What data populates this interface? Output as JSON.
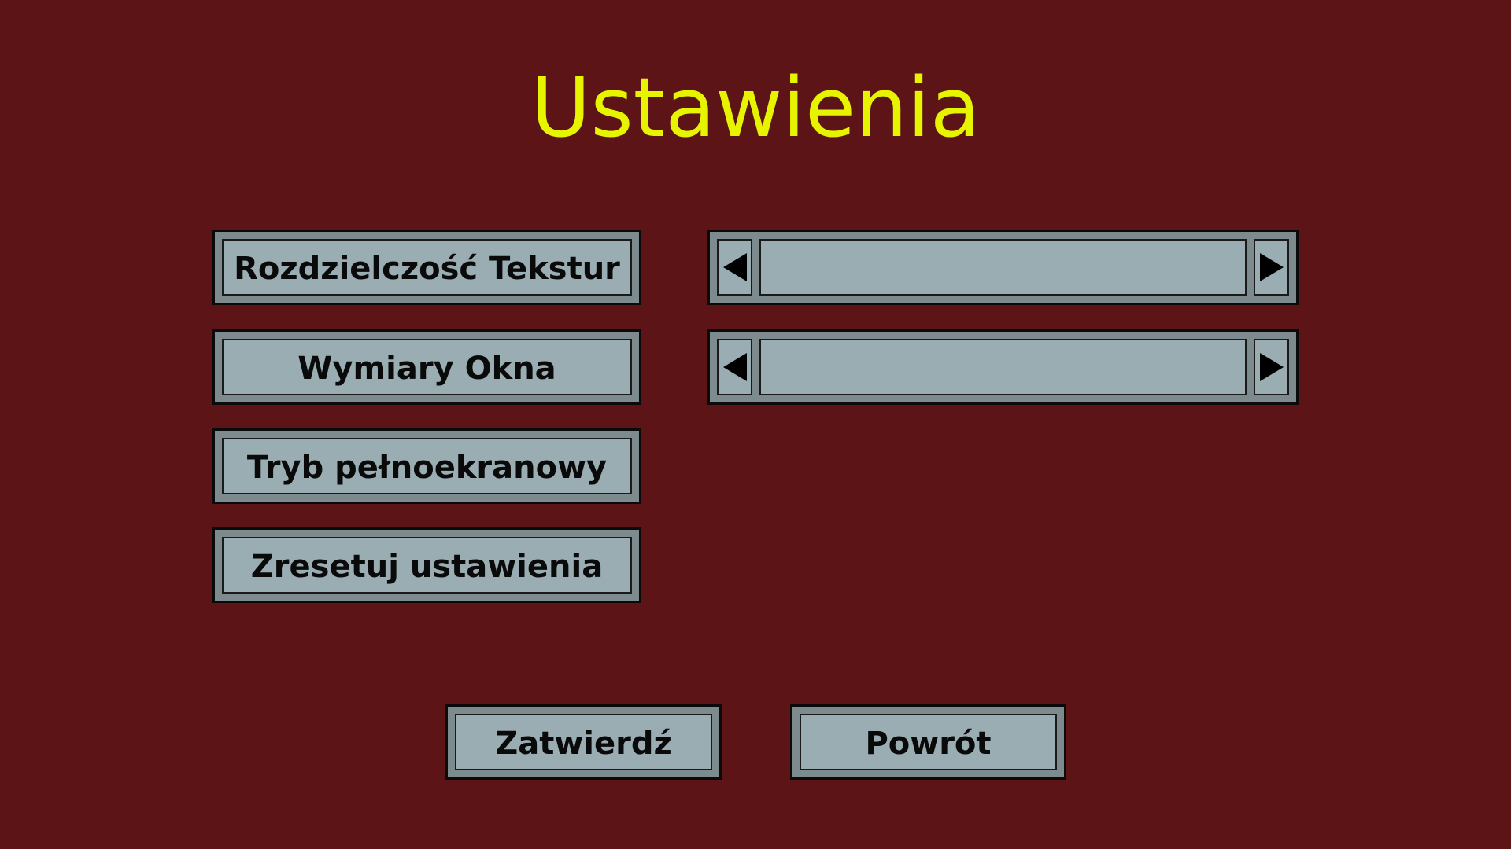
{
  "title": "Ustawienia",
  "colors": {
    "background": "#5c1416",
    "title": "#e6f400",
    "button_frame": "#7d8a8e",
    "button_face": "#99adb3",
    "text": "#0a0a0a"
  },
  "options": [
    {
      "label": "Rozdzielczość Tekstur"
    },
    {
      "label": "Wymiary Okna"
    },
    {
      "label": "Tryb pełnoekranowy"
    },
    {
      "label": "Zresetuj ustawienia"
    }
  ],
  "selectors": [
    {
      "value": "",
      "left_icon": "arrow-left-icon",
      "right_icon": "arrow-right-icon"
    },
    {
      "value": "",
      "left_icon": "arrow-left-icon",
      "right_icon": "arrow-right-icon"
    }
  ],
  "footer": {
    "confirm_label": "Zatwierdź",
    "back_label": "Powrót"
  }
}
